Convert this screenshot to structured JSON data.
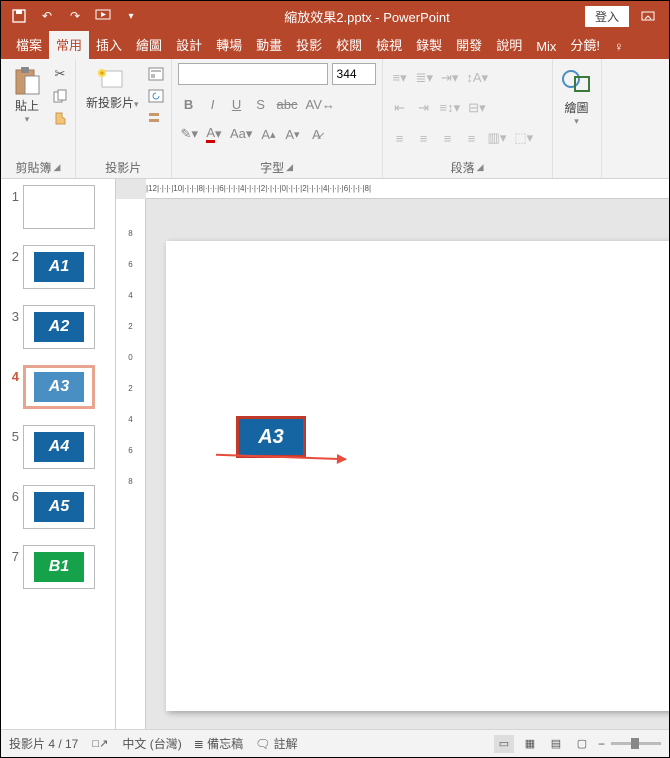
{
  "title": "縮放效果2.pptx - PowerPoint",
  "login_label": "登入",
  "tabs": [
    "檔案",
    "常用",
    "插入",
    "繪圖",
    "設計",
    "轉場",
    "動畫",
    "投影",
    "校閱",
    "檢視",
    "錄製",
    "開發",
    "說明",
    "Mix",
    "分鏡!"
  ],
  "active_tab_index": 1,
  "groups": {
    "clipboard": "剪貼簿",
    "slides": "投影片",
    "font": "字型",
    "paragraph": "段落",
    "drawing": "繪圖"
  },
  "paste_label": "貼上",
  "newslide_label": "新投影片",
  "font_size": "344",
  "drawing_label": "繪圖",
  "hruler_text": "|12|·|·|·|10|·|·|·|8|·|·|·|6|·|·|·|4|·|·|·|2|·|·|·|0|·|·|·|2|·|·|·|4|·|·|·|6|·|·|·|8|",
  "vruler_marks": [
    "8",
    "6",
    "4",
    "2",
    "0",
    "2",
    "4",
    "6",
    "8"
  ],
  "thumbs": [
    {
      "n": "1",
      "label": "",
      "bg": "#ffffff",
      "fg": "#000"
    },
    {
      "n": "2",
      "label": "A1",
      "bg": "#1565a2",
      "fg": "#fff"
    },
    {
      "n": "3",
      "label": "A2",
      "bg": "#1565a2",
      "fg": "#fff"
    },
    {
      "n": "4",
      "label": "A3",
      "bg": "#4a8fc4",
      "fg": "#fff",
      "selected": true
    },
    {
      "n": "5",
      "label": "A4",
      "bg": "#1565a2",
      "fg": "#fff"
    },
    {
      "n": "6",
      "label": "A5",
      "bg": "#1565a2",
      "fg": "#fff"
    },
    {
      "n": "7",
      "label": "B1",
      "bg": "#15a24a",
      "fg": "#fff"
    }
  ],
  "slide_shape_label": "A3",
  "status": {
    "slide_counter": "投影片 4 / 17",
    "lang": "中文 (台灣)",
    "notes": "備忘稿",
    "comments": "註解"
  }
}
